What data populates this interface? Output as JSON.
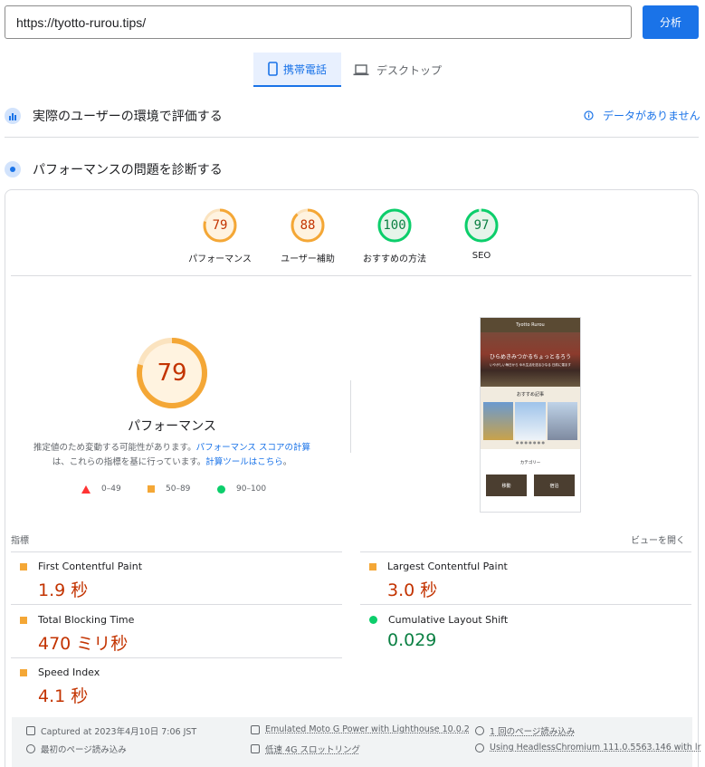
{
  "url_bar": {
    "value": "https://tyotto-rurou.tips/",
    "analyze_label": "分析"
  },
  "tabs": {
    "mobile": "携帯電話",
    "desktop": "デスクトップ"
  },
  "field_section": {
    "title": "実際のユーザーの環境で評価する",
    "no_data": "データがありません"
  },
  "lab_section": {
    "title": "パフォーマンスの問題を診断する"
  },
  "scores": [
    {
      "value": "79",
      "label": "パフォーマンス",
      "score": 79,
      "color": "#f4a736"
    },
    {
      "value": "88",
      "label": "ユーザー補助",
      "score": 88,
      "color": "#f4a736"
    },
    {
      "value": "100",
      "label": "おすすめの方法",
      "score": 100,
      "color": "#0cce6b"
    },
    {
      "value": "97",
      "label": "SEO",
      "score": 97,
      "color": "#0cce6b"
    }
  ],
  "main_gauge": {
    "value": "79",
    "title": "パフォーマンス",
    "score": 79
  },
  "description": {
    "text1": "推定値のため変動する可能性があります。",
    "link1": "パフォーマンス スコアの計算",
    "text2": "は、これらの指標を基に行っています。",
    "link2": "計算ツールはこちら",
    "text3": "。"
  },
  "legend": {
    "fail": "0–49",
    "average": "50–89",
    "pass": "90–100"
  },
  "thumbnail": {
    "site_name": "Tyotto Rurou",
    "hero_text": "ひらめきみつかるちょっとるろう",
    "hero_sub": "いやがしい毎日から ゆれ生活を送るひなる 日前に運ます",
    "recommended": "おすすめ記事",
    "category": "カテゴリー",
    "cat1": "移動",
    "cat2": "宿泊"
  },
  "metrics": {
    "header": "指標",
    "expand": "ビューを開く",
    "fcp": {
      "name": "First Contentful Paint",
      "value": "1.9 秒"
    },
    "lcp": {
      "name": "Largest Contentful Paint",
      "value": "3.0 秒"
    },
    "tbt": {
      "name": "Total Blocking Time",
      "value": "470 ミリ秒"
    },
    "cls": {
      "name": "Cumulative Layout Shift",
      "value": "0.029"
    },
    "si": {
      "name": "Speed Index",
      "value": "4.1 秒"
    }
  },
  "run_info": {
    "captured": "Captured at 2023年4月10日 7:06 JST",
    "device": "Emulated Moto G Power with Lighthouse 10.0.2",
    "page_loads": "1 回のページ読み込み",
    "initial_load": "最初のページ読み込み",
    "throttling": "低速 4G スロットリング",
    "browser": "Using HeadlessChromium 111.0.5563.146 with lr"
  },
  "colors": {
    "accent": "#1a73e8",
    "average": "#f4a736",
    "pass": "#0cce6b",
    "fail": "#ff3333"
  }
}
